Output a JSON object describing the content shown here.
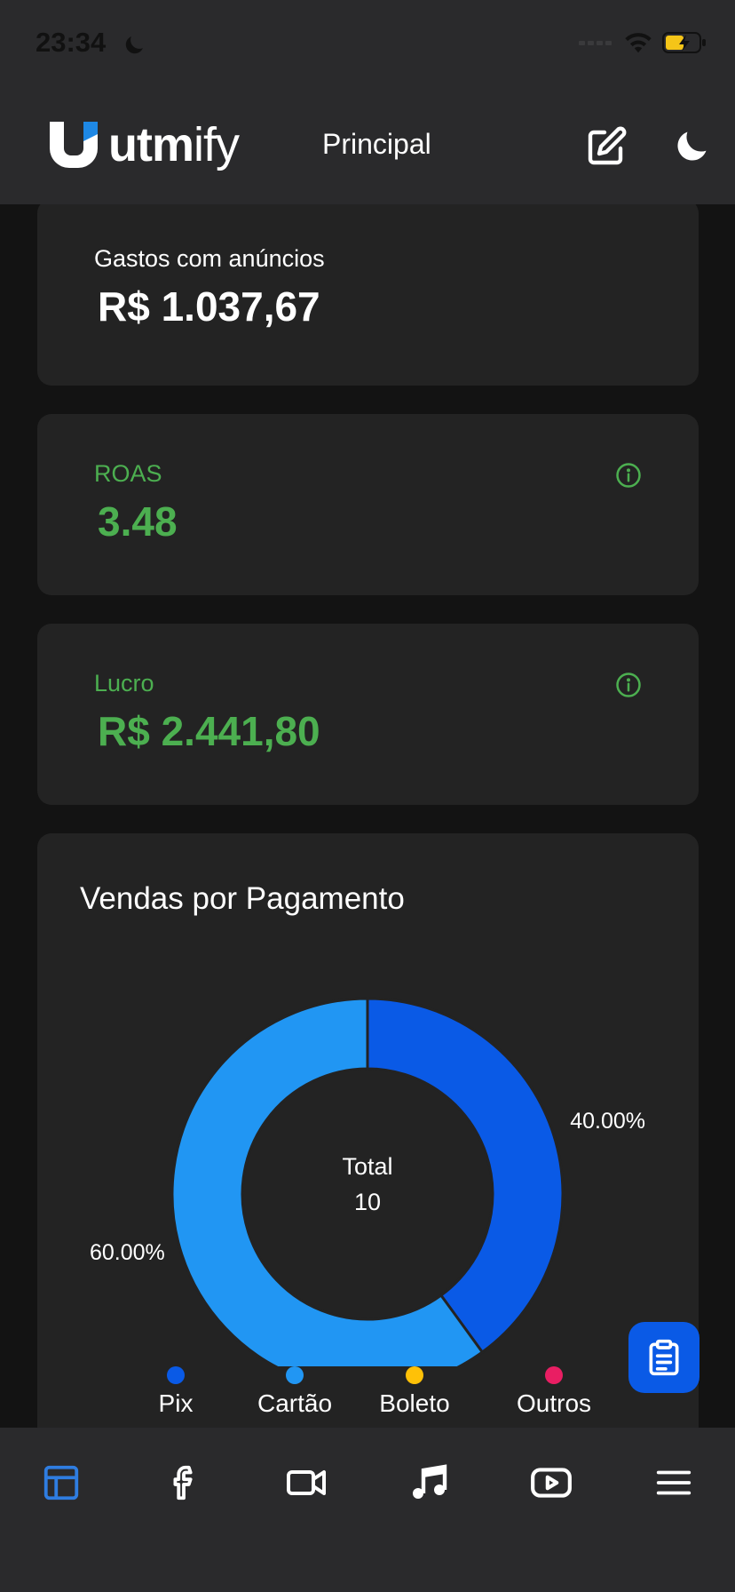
{
  "status_bar": {
    "time": "23:34"
  },
  "header": {
    "logo_text_bold": "utm",
    "logo_text_light": "ify",
    "page_title": "Principal"
  },
  "cards": {
    "ad_spend": {
      "label": "Gastos com anúncios",
      "value": "R$ 1.037,67"
    },
    "roas": {
      "label": "ROAS",
      "value": "3.48"
    },
    "profit": {
      "label": "Lucro",
      "value": "R$ 2.441,80"
    }
  },
  "colors": {
    "accent_green": "#4caf50",
    "pix_blue": "#0a5ae6",
    "card_blue": "#2196f3",
    "boleto_yellow": "#ffc107",
    "outros_pink": "#e91e63"
  },
  "chart_data": {
    "type": "pie",
    "title": "Vendas por Pagamento",
    "center_label": "Total",
    "center_value": "10",
    "slices": [
      {
        "name": "Pix",
        "value": 40.0,
        "label": "40.00%",
        "color": "#0a5ae6"
      },
      {
        "name": "Cartão",
        "value": 60.0,
        "label": "60.00%",
        "color": "#2196f3"
      }
    ],
    "legend": [
      {
        "name": "Pix",
        "color": "#0a5ae6"
      },
      {
        "name": "Cartão",
        "color": "#2196f3"
      },
      {
        "name": "Boleto",
        "color": "#ffc107"
      },
      {
        "name": "Outros",
        "color": "#e91e63"
      }
    ],
    "legend_position": "bottom"
  },
  "icons": {
    "header": [
      "edit-icon",
      "moon-icon"
    ],
    "nav": [
      "dashboard-icon",
      "facebook-icon",
      "video-icon",
      "music-icon",
      "youtube-icon",
      "menu-icon"
    ],
    "fab": "clipboard-icon"
  }
}
